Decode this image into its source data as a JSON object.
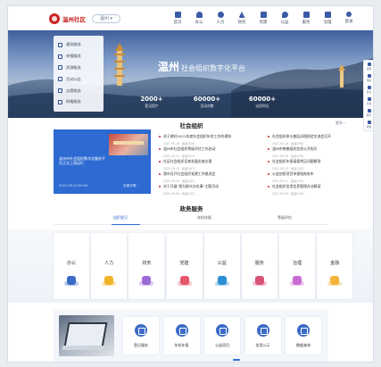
{
  "header": {
    "logo_text": "温州社区",
    "region_label": "温州 ▾",
    "nav": [
      "首页",
      "办公",
      "人力",
      "财务",
      "党建",
      "公益",
      "服务",
      "治理",
      "登录"
    ]
  },
  "hero": {
    "title": "温州",
    "subtitle": "社会组织数字化平台",
    "menu": [
      "通讯服务",
      "申报服务",
      "资源服务",
      "活动公告",
      "志愿服务",
      "网格服务"
    ],
    "stats": [
      {
        "value": "2000+",
        "label": "登记用户"
      },
      {
        "value": "60000+",
        "label": "活动次数"
      },
      {
        "value": "60000+",
        "label": "志愿时长"
      }
    ],
    "side_tools": [
      "客服",
      "帮助",
      "反馈",
      "咨询",
      "服务",
      "收藏"
    ]
  },
  "org": {
    "title": "社会组织",
    "more": "更多 ›",
    "featured_text": "温州市社会组织数字化服务平台正式上线运行",
    "featured_date": "2021-05-20 09:00",
    "featured_more": "查看详情 ›",
    "list_left": [
      {
        "title": "关于做好2021年度社会组织年检工作的通知",
        "meta": "2021-05-18  ·  阅读(326)"
      },
      {
        "title": "温州市社会组织等级评估工作启动",
        "meta": "2021-05-15  ·  阅读(211)"
      },
      {
        "title": "社区社会组织培育发展实施方案",
        "meta": "2021-05-12  ·  阅读(187)"
      },
      {
        "title": "我市召开社会组织党建工作推进会",
        "meta": "2021-05-10  ·  阅读(164)"
      },
      {
        "title": "关于开展\"我为群众办实事\"主题活动",
        "meta": "2021-05-08  ·  阅读(152)"
      }
    ],
    "list_right": [
      {
        "title": "社会组织参与基层治理经验交流会召开",
        "meta": "2021-05-18  ·  阅读(298)"
      },
      {
        "title": "温州市慈善组织信息公开指引",
        "meta": "2021-05-16  ·  阅读(176)"
      },
      {
        "title": "社会组织年报填报常见问题解答",
        "meta": "2021-05-13  ·  阅读(143)"
      },
      {
        "title": "公益创投项目申报指南发布",
        "meta": "2021-05-11  ·  阅读(129)"
      },
      {
        "title": "社会组织信用信息管理办法解读",
        "meta": "2021-05-09  ·  阅读(118)"
      }
    ]
  },
  "gov": {
    "title": "政务服务",
    "tabs": [
      "组织登记",
      "年检年报",
      "等级评估"
    ],
    "services": [
      "办公",
      "人力",
      "财务",
      "党建",
      "公益",
      "服务",
      "治理",
      "金融"
    ],
    "colors": [
      "#3b6bc6",
      "#f0b429",
      "#9b6ad8",
      "#e4566a",
      "#2d8fd6",
      "#d9527a",
      "#c86ad2",
      "#f2b43a"
    ]
  },
  "quick": {
    "items": [
      "登记服务",
      "年检年报",
      "公益项目",
      "信用公示",
      "数据查询"
    ]
  }
}
